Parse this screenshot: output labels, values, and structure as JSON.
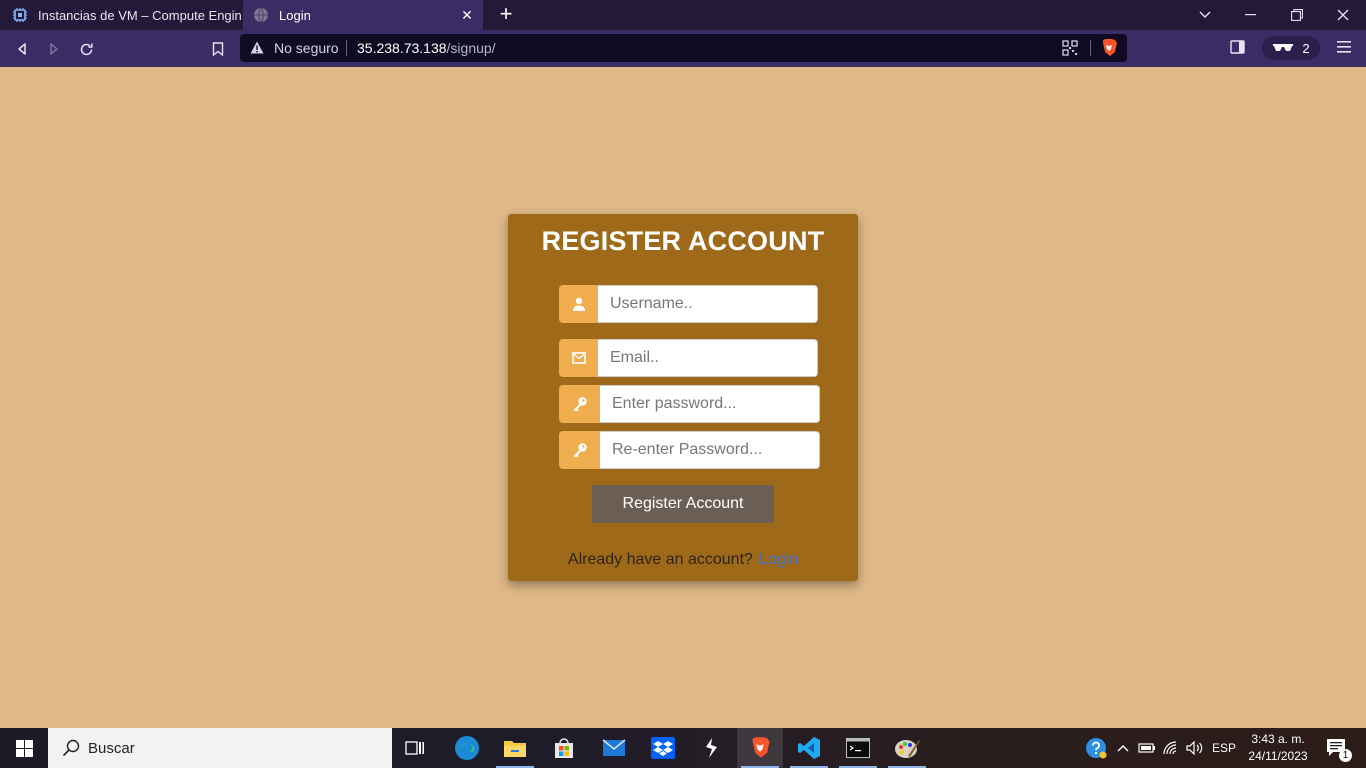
{
  "browser": {
    "tabs": [
      {
        "title": "Instancias de VM – Compute Engine –",
        "active": false
      },
      {
        "title": "Login",
        "active": true
      }
    ],
    "url": {
      "security_label": "No seguro",
      "host": "35.238.73.138",
      "path": "/signup/"
    },
    "vpn_badge_count": "2",
    "colors": {
      "chrome_dark": "#221a38",
      "chrome": "#3b2c66",
      "urlbar": "#0f0b22"
    }
  },
  "page": {
    "background": "#deb887",
    "card_color": "#9e6a1a",
    "title": "REGISTER ACCOUNT",
    "fields": {
      "username_placeholder": "Username..",
      "email_placeholder": "Email..",
      "password_placeholder": "Enter password...",
      "repassword_placeholder": "Re-enter Password..."
    },
    "icons": {
      "username": "user-icon",
      "email": "envelope-icon",
      "password": "key-icon",
      "repassword": "key-icon"
    },
    "register_button": "Register Account",
    "login_prompt": "Already have an account?",
    "login_link": "Login",
    "accent": "#f0ad4e"
  },
  "taskbar": {
    "search_placeholder": "Buscar",
    "apps": [
      "task-view",
      "edge",
      "file-explorer",
      "microsoft-store",
      "mail",
      "dropbox",
      "sublime-like",
      "brave",
      "vscode",
      "terminal",
      "paint"
    ],
    "language": "ESP",
    "time": "3:43 a. m.",
    "date": "24/11/2023",
    "notification_count": "1"
  }
}
